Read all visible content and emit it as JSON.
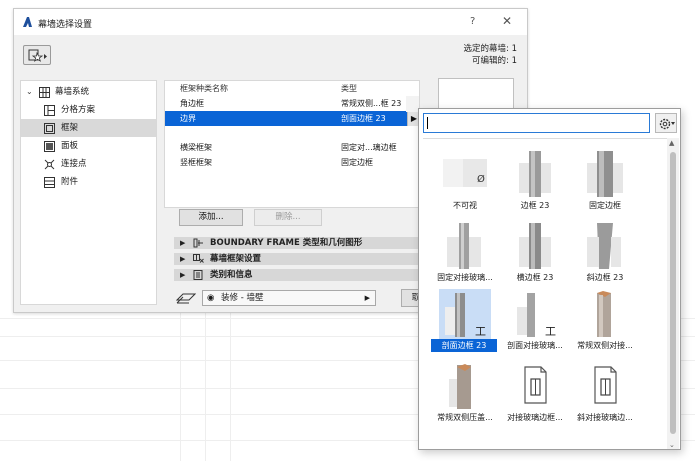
{
  "dialog": {
    "title": "幕墙选择设置",
    "help_label": "?",
    "close_label": "✕",
    "selected_count": "选定的幕墙: 1",
    "editable_count": "可编辑的: 1"
  },
  "tree": {
    "root_label": "幕墙系统",
    "items": [
      {
        "label": "分格方案",
        "icon": "grid-scheme-icon"
      },
      {
        "label": "框架",
        "icon": "frame-icon"
      },
      {
        "label": "面板",
        "icon": "panel-icon"
      },
      {
        "label": "连接点",
        "icon": "junction-icon"
      },
      {
        "label": "附件",
        "icon": "accessory-icon"
      }
    ],
    "selected_index": 1
  },
  "frames_table": {
    "header_name": "框架种类名称",
    "header_type": "类型",
    "rows": [
      {
        "name": "角边框",
        "type": "常规双侧...框 23"
      },
      {
        "name": "边界",
        "type": "剖面边框 23"
      },
      {
        "name": "横梁框架",
        "type": "固定对...璃边框"
      },
      {
        "name": "竖框框架",
        "type": "固定边框"
      }
    ],
    "selected_index": 1
  },
  "buttons": {
    "add": "添加...",
    "delete": "删除...",
    "cancel": "取"
  },
  "sections": [
    {
      "label": "BOUNDARY FRAME 类型和几何图形",
      "icon": "frame-geometry-icon"
    },
    {
      "label": "幕墙框架设置",
      "icon": "frame-settings-icon"
    },
    {
      "label": "类别和信息",
      "icon": "info-list-icon"
    }
  ],
  "layer": {
    "value": "装修 - 墙壁"
  },
  "gallery": {
    "search_value": "",
    "items": [
      {
        "label": "不可视"
      },
      {
        "label": "边框 23"
      },
      {
        "label": "固定边框"
      },
      {
        "label": "固定对接玻璃..."
      },
      {
        "label": "横边框 23"
      },
      {
        "label": "斜边框 23"
      },
      {
        "label": "剖面边框 23"
      },
      {
        "label": "剖面对接玻璃..."
      },
      {
        "label": "常规双侧对接..."
      },
      {
        "label": "常规双侧压盖..."
      },
      {
        "label": "对接玻璃边框..."
      },
      {
        "label": "斜对接玻璃边..."
      }
    ],
    "selected_index": 6,
    "invisible_symbol": "Ø",
    "profile_glyph": "工"
  },
  "colors": {
    "selection": "#0a64d6",
    "focus_border": "#2a7ad6"
  }
}
